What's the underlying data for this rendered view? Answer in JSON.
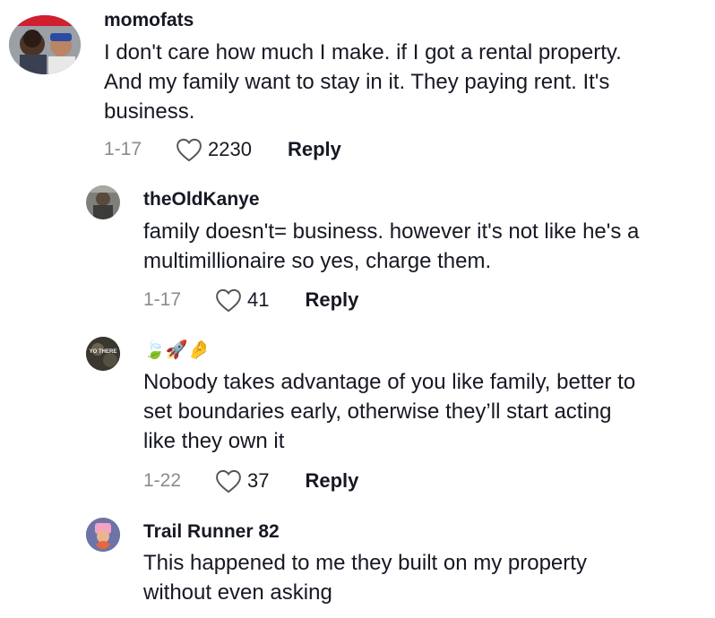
{
  "colors": {
    "text": "#161823",
    "meta": "#8a8b91",
    "background": "#ffffff"
  },
  "comments": [
    {
      "username": "momofats",
      "text": "I don't care how much I make. if I got a rental property.\nAnd my family want to stay in it. They paying rent. It's\nbusiness.",
      "date": "1-17",
      "likes": "2230",
      "reply_label": "Reply"
    },
    {
      "username": "theOldKanye",
      "text": "family doesn't= business. however it's not like he's a\nmultimillionaire so yes, charge them.",
      "date": "1-17",
      "likes": "41",
      "reply_label": "Reply"
    },
    {
      "username": "🍃🚀🤌",
      "avatar_text": "YO THERE",
      "text": "Nobody takes advantage of you like family, better to\nset boundaries early, otherwise they’ll start acting\nlike they own it",
      "date": "1-22",
      "likes": "37",
      "reply_label": "Reply"
    },
    {
      "username": "Trail Runner 82",
      "text": "This happened to me they built on my property\nwithout even asking"
    }
  ]
}
